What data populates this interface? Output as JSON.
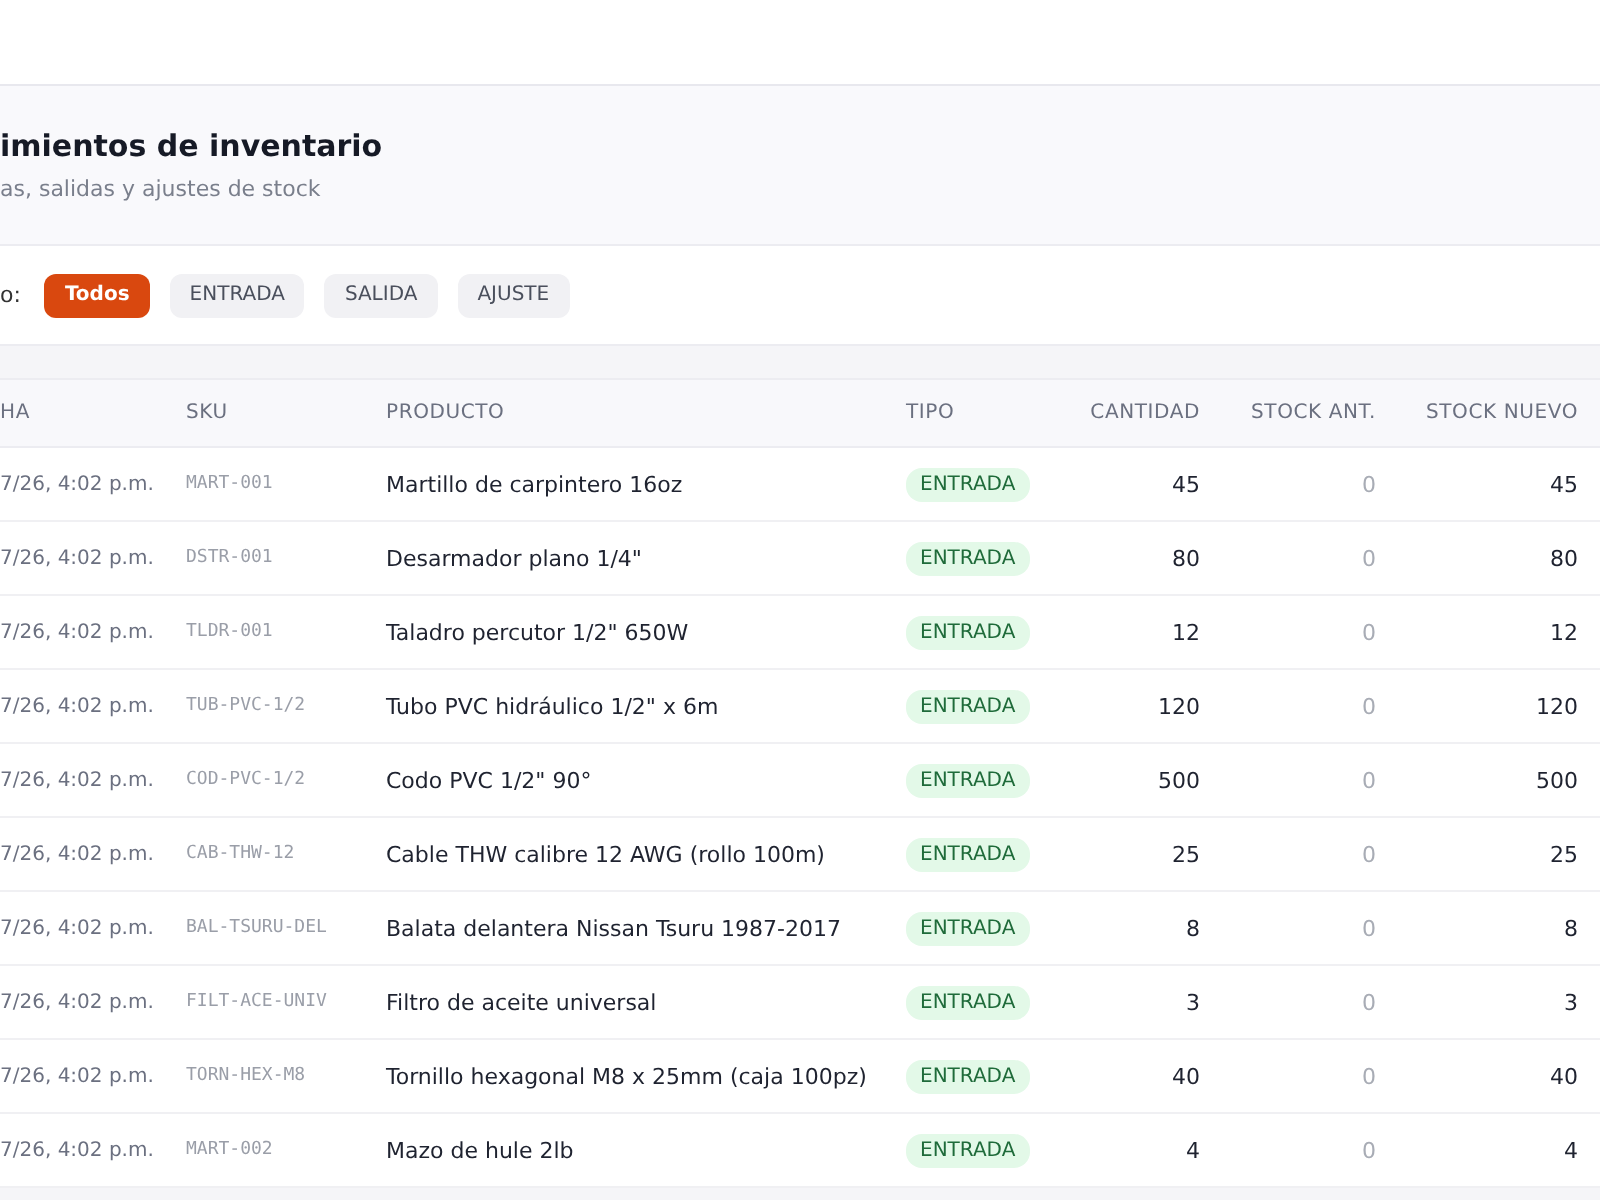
{
  "header": {
    "title": "imientos de inventario",
    "subtitle": "as, salidas y ajustes de stock"
  },
  "filter": {
    "label": "o:",
    "chips": [
      {
        "label": "Todos",
        "selected": true
      },
      {
        "label": "ENTRADA",
        "selected": false
      },
      {
        "label": "SALIDA",
        "selected": false
      },
      {
        "label": "AJUSTE",
        "selected": false
      }
    ]
  },
  "table": {
    "columns": [
      "HA",
      "SKU",
      "PRODUCTO",
      "TIPO",
      "CANTIDAD",
      "STOCK ANT.",
      "STOCK NUEVO"
    ],
    "rows": [
      {
        "date": "7/26, 4:02 p.m.",
        "sku": "MART-001",
        "product": "Martillo de carpintero 16oz",
        "type": "ENTRADA",
        "quantity": "45",
        "stock_before": "0",
        "stock_after": "45"
      },
      {
        "date": "7/26, 4:02 p.m.",
        "sku": "DSTR-001",
        "product": "Desarmador plano 1/4\"",
        "type": "ENTRADA",
        "quantity": "80",
        "stock_before": "0",
        "stock_after": "80"
      },
      {
        "date": "7/26, 4:02 p.m.",
        "sku": "TLDR-001",
        "product": "Taladro percutor 1/2\" 650W",
        "type": "ENTRADA",
        "quantity": "12",
        "stock_before": "0",
        "stock_after": "12"
      },
      {
        "date": "7/26, 4:02 p.m.",
        "sku": "TUB-PVC-1/2",
        "product": "Tubo PVC hidráulico 1/2\" x 6m",
        "type": "ENTRADA",
        "quantity": "120",
        "stock_before": "0",
        "stock_after": "120"
      },
      {
        "date": "7/26, 4:02 p.m.",
        "sku": "COD-PVC-1/2",
        "product": "Codo PVC 1/2\" 90°",
        "type": "ENTRADA",
        "quantity": "500",
        "stock_before": "0",
        "stock_after": "500"
      },
      {
        "date": "7/26, 4:02 p.m.",
        "sku": "CAB-THW-12",
        "product": "Cable THW calibre 12 AWG (rollo 100m)",
        "type": "ENTRADA",
        "quantity": "25",
        "stock_before": "0",
        "stock_after": "25"
      },
      {
        "date": "7/26, 4:02 p.m.",
        "sku": "BAL-TSURU-DEL",
        "product": "Balata delantera Nissan Tsuru 1987-2017",
        "type": "ENTRADA",
        "quantity": "8",
        "stock_before": "0",
        "stock_after": "8"
      },
      {
        "date": "7/26, 4:02 p.m.",
        "sku": "FILT-ACE-UNIV",
        "product": "Filtro de aceite universal",
        "type": "ENTRADA",
        "quantity": "3",
        "stock_before": "0",
        "stock_after": "3"
      },
      {
        "date": "7/26, 4:02 p.m.",
        "sku": "TORN-HEX-M8",
        "product": "Tornillo hexagonal M8 x 25mm (caja 100pz)",
        "type": "ENTRADA",
        "quantity": "40",
        "stock_before": "0",
        "stock_after": "40"
      },
      {
        "date": "7/26, 4:02 p.m.",
        "sku": "MART-002",
        "product": "Mazo de hule 2lb",
        "type": "ENTRADA",
        "quantity": "4",
        "stock_before": "0",
        "stock_after": "4"
      }
    ]
  }
}
